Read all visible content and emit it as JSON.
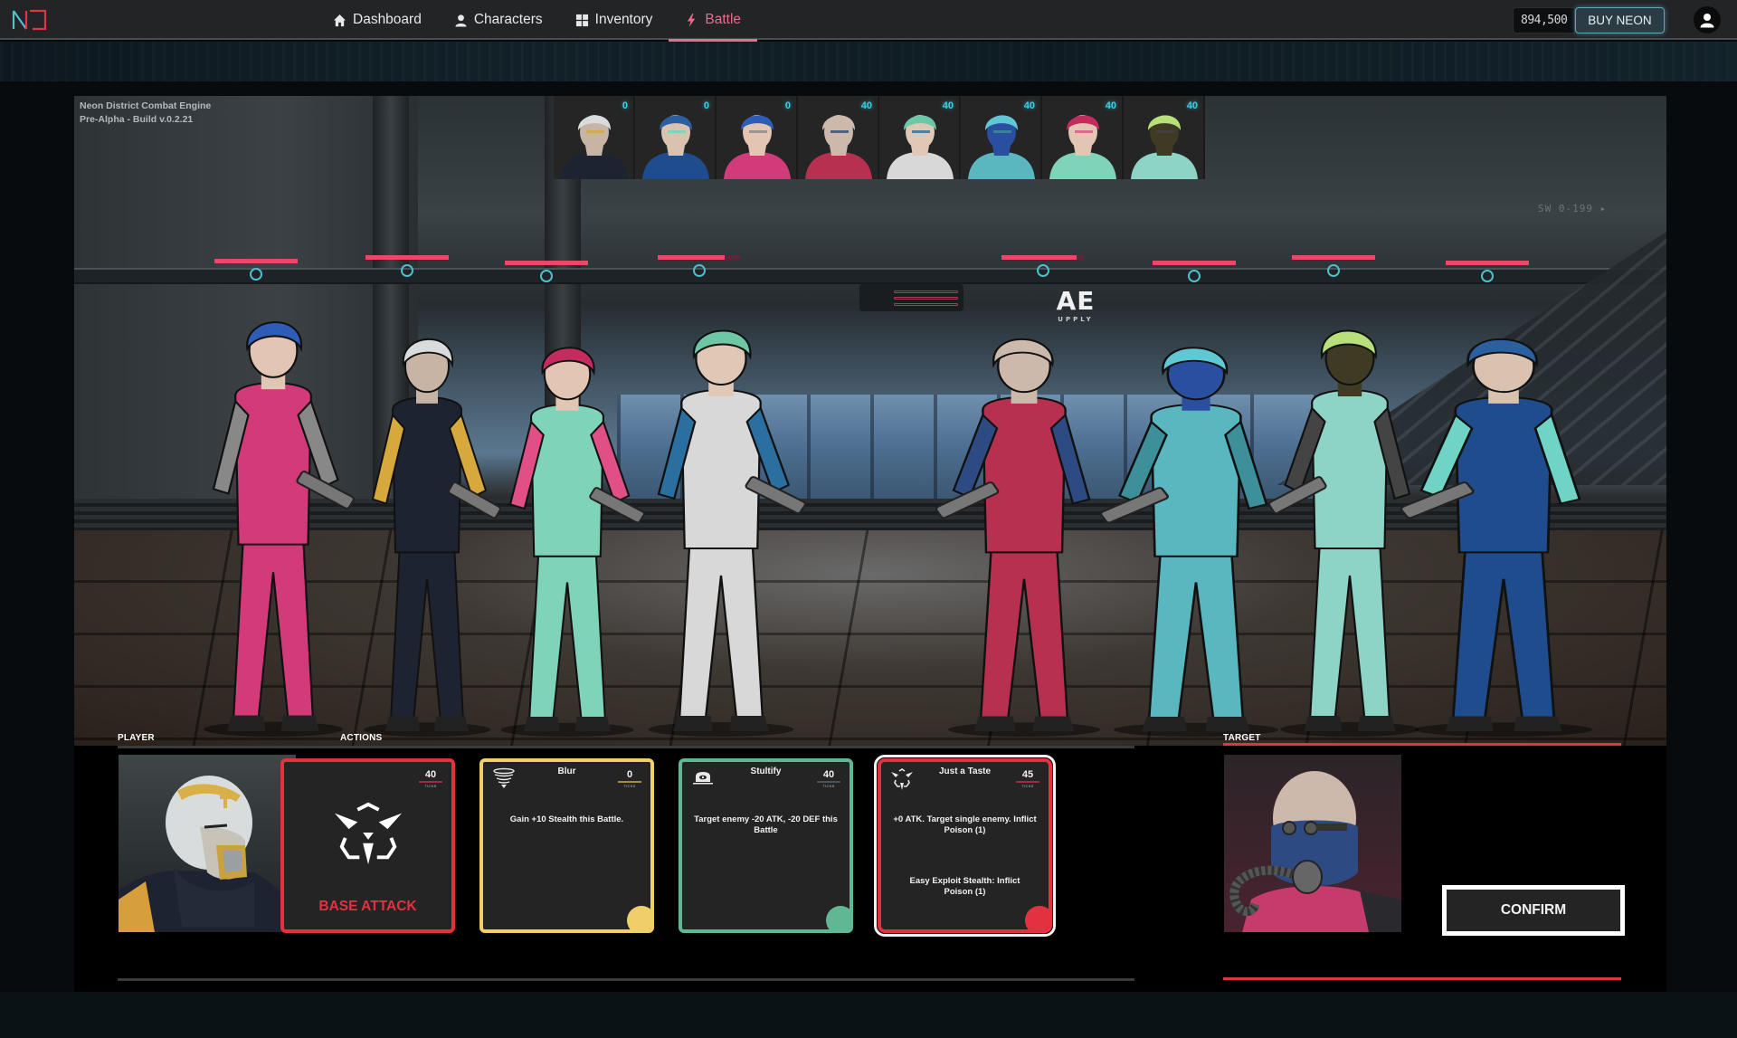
{
  "nav": {
    "logo": "ND",
    "items": [
      {
        "label": "Dashboard",
        "icon": "home-icon",
        "active": false
      },
      {
        "label": "Characters",
        "icon": "user-icon",
        "active": false
      },
      {
        "label": "Inventory",
        "icon": "grid-icon",
        "active": false
      },
      {
        "label": "Battle",
        "icon": "bolt-icon",
        "active": true
      }
    ],
    "balance": "894,500",
    "buy_label": "BUY NEON",
    "account_icon": "user-circle-icon"
  },
  "colors": {
    "accent_pink": "#ef6a8f",
    "hp": "#ef4566",
    "ticks_cyan": "#35d0e6",
    "red": "#e4313f",
    "yellow": "#f0cf6a",
    "green": "#5fb893"
  },
  "build": {
    "line1": "Neon District Combat Engine",
    "line2": "Pre-Alpha - Build v.0.2.21"
  },
  "scene": {
    "sign_ae": "AE",
    "sign_ae_sub": "UPPLY",
    "sign_sw": "SW 0-199 ▸"
  },
  "turn_order": [
    {
      "name": "helmet-masked",
      "ticks": "0"
    },
    {
      "name": "blue-hood",
      "ticks": "0"
    },
    {
      "name": "blue-hair-eyepatch",
      "ticks": "0"
    },
    {
      "name": "gasmask-bald",
      "ticks": "40"
    },
    {
      "name": "green-hair-headphones",
      "ticks": "40"
    },
    {
      "name": "blue-face-cyan-hair",
      "ticks": "40"
    },
    {
      "name": "red-hair-goggles",
      "ticks": "40"
    },
    {
      "name": "lime-hair-mask",
      "ticks": "40"
    }
  ],
  "combatants": [
    {
      "name": "blue-hair-eyepatch",
      "team": "player",
      "hp_pct": 100
    },
    {
      "name": "helmet-masked",
      "team": "player",
      "hp_pct": 100
    },
    {
      "name": "red-hair-goggles",
      "team": "player",
      "hp_pct": 100
    },
    {
      "name": "green-hair-headphones",
      "team": "player",
      "hp_pct": 80
    },
    {
      "name": "gasmask-bald",
      "team": "enemy",
      "hp_pct": 90
    },
    {
      "name": "blue-face-cyan-hair",
      "team": "enemy",
      "hp_pct": 100
    },
    {
      "name": "lime-hair-mask",
      "team": "enemy",
      "hp_pct": 100
    },
    {
      "name": "blue-hood",
      "team": "enemy",
      "hp_pct": 100
    }
  ],
  "panel": {
    "player_label": "PLAYER",
    "actions_label": "ACTIONS",
    "target_label": "TARGET",
    "confirm_label": "CONFIRM"
  },
  "cards": [
    {
      "id": "base-attack",
      "title": "",
      "label": "BASE ATTACK",
      "ticks": "40",
      "ticks_unit": "TICKS",
      "desc": "",
      "desc2": "",
      "color": "#e4313f",
      "selected": false
    },
    {
      "id": "blur",
      "title": "Blur",
      "label": "",
      "ticks": "0",
      "ticks_unit": "TICKS",
      "desc": "Gain +10 Stealth this Battle.",
      "desc2": "",
      "color": "#f0cf6a",
      "selected": false
    },
    {
      "id": "stultify",
      "title": "Stultify",
      "label": "",
      "ticks": "40",
      "ticks_unit": "TICKS",
      "desc": "Target enemy -20 ATK, -20 DEF this Battle",
      "desc2": "",
      "color": "#5fb893",
      "selected": false
    },
    {
      "id": "just-a-taste",
      "title": "Just a Taste",
      "label": "",
      "ticks": "45",
      "ticks_unit": "TICKS",
      "desc": "+0 ATK. Target single enemy. Inflict Poison (1)",
      "desc2": "Easy Exploit Stealth: Inflict Poison (1)",
      "color": "#e4313f",
      "selected": true
    }
  ]
}
